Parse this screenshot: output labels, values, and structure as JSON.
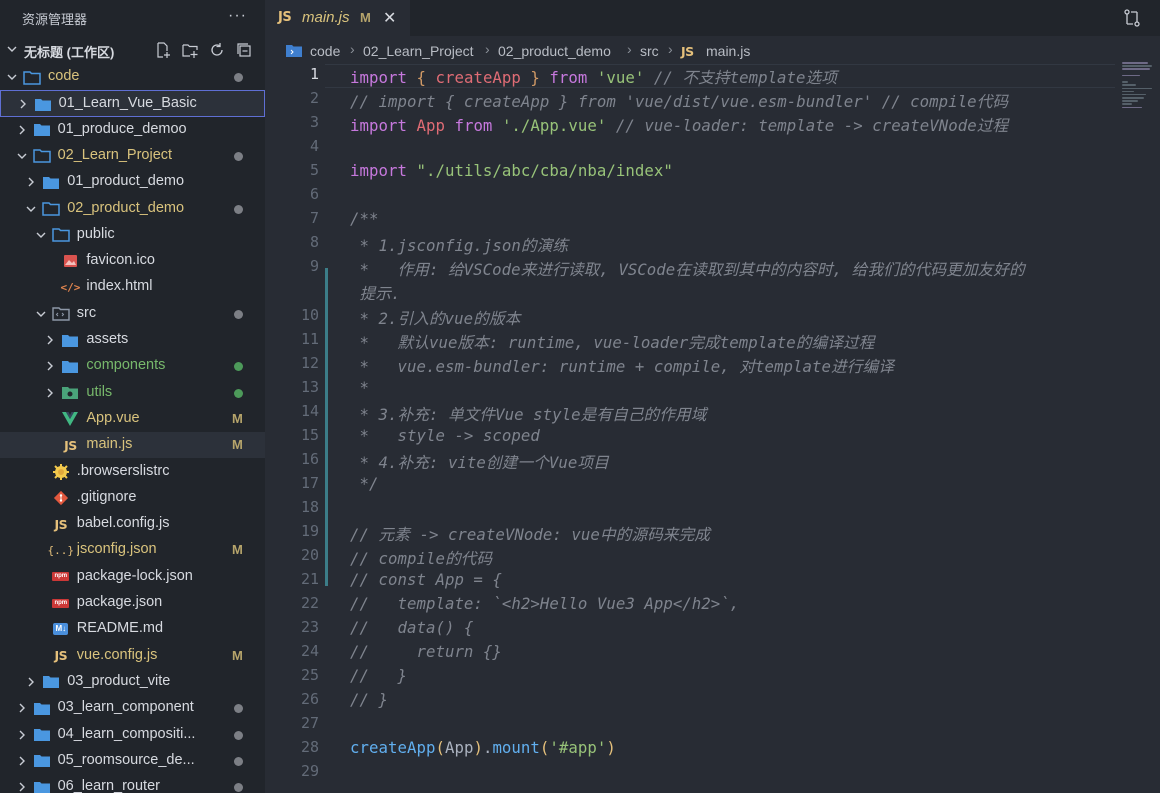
{
  "sidebar": {
    "title": "资源管理器",
    "more": "···",
    "workspace": "无标题 (工作区)",
    "tree": [
      {
        "label": "code",
        "depth": 0,
        "type": "folder-open",
        "status": "dot",
        "color": "mod"
      },
      {
        "label": "01_Learn_Vue_Basic",
        "depth": 1,
        "type": "folder",
        "status": "",
        "color": "norm",
        "selected": true
      },
      {
        "label": "01_produce_demoo",
        "depth": 1,
        "type": "folder",
        "status": "",
        "color": "norm"
      },
      {
        "label": "02_Learn_Project",
        "depth": 1,
        "type": "folder-open",
        "status": "dot",
        "color": "mod"
      },
      {
        "label": "01_product_demo",
        "depth": 2,
        "type": "folder",
        "status": "",
        "color": "norm"
      },
      {
        "label": "02_product_demo",
        "depth": 2,
        "type": "folder-open",
        "status": "dot",
        "color": "mod"
      },
      {
        "label": "public",
        "depth": 3,
        "type": "folder-open",
        "status": "",
        "color": "norm"
      },
      {
        "label": "favicon.ico",
        "depth": 4,
        "type": "image",
        "status": "",
        "color": "norm"
      },
      {
        "label": "index.html",
        "depth": 4,
        "type": "html",
        "status": "",
        "color": "norm"
      },
      {
        "label": "src",
        "depth": 3,
        "type": "src",
        "status": "dot",
        "color": "norm"
      },
      {
        "label": "assets",
        "depth": 4,
        "type": "folder",
        "status": "",
        "color": "norm",
        "chev": true
      },
      {
        "label": "components",
        "depth": 4,
        "type": "folder",
        "status": "green",
        "color": "green",
        "chev": true
      },
      {
        "label": "utils",
        "depth": 4,
        "type": "utils",
        "status": "green",
        "color": "green",
        "chev": true
      },
      {
        "label": "App.vue",
        "depth": 4,
        "type": "vue",
        "status": "M",
        "color": "mod"
      },
      {
        "label": "main.js",
        "depth": 4,
        "type": "js",
        "status": "M",
        "color": "mod",
        "active": true
      },
      {
        "label": ".browserslistrc",
        "depth": 3,
        "type": "browsers",
        "status": "",
        "color": "norm"
      },
      {
        "label": ".gitignore",
        "depth": 3,
        "type": "git",
        "status": "",
        "color": "norm"
      },
      {
        "label": "babel.config.js",
        "depth": 3,
        "type": "js",
        "status": "",
        "color": "norm"
      },
      {
        "label": "jsconfig.json",
        "depth": 3,
        "type": "json",
        "status": "M",
        "color": "mod"
      },
      {
        "label": "package-lock.json",
        "depth": 3,
        "type": "npm",
        "status": "",
        "color": "norm"
      },
      {
        "label": "package.json",
        "depth": 3,
        "type": "npm",
        "status": "",
        "color": "norm"
      },
      {
        "label": "README.md",
        "depth": 3,
        "type": "md",
        "status": "",
        "color": "norm"
      },
      {
        "label": "vue.config.js",
        "depth": 3,
        "type": "js",
        "status": "M",
        "color": "mod"
      },
      {
        "label": "03_product_vite",
        "depth": 2,
        "type": "folder",
        "status": "",
        "color": "norm"
      },
      {
        "label": "03_learn_component",
        "depth": 1,
        "type": "folder",
        "status": "dot",
        "color": "norm"
      },
      {
        "label": "04_learn_compositi...",
        "depth": 1,
        "type": "folder",
        "status": "dot",
        "color": "norm"
      },
      {
        "label": "05_roomsource_de...",
        "depth": 1,
        "type": "folder",
        "status": "dot",
        "color": "norm"
      },
      {
        "label": "06_learn_router",
        "depth": 1,
        "type": "folder",
        "status": "dot",
        "color": "norm"
      }
    ]
  },
  "editor": {
    "tab": {
      "badge": "JS",
      "name": "main.js",
      "modified": "M",
      "close": "✕"
    },
    "breadcrumb": [
      "code",
      "02_Learn_Project",
      "02_product_demo",
      "src",
      "main.js"
    ],
    "breadcrumb_js_badge": "JS",
    "line_numbers": [
      "1",
      "2",
      "3",
      "4",
      "5",
      "6",
      "7",
      "8",
      "9",
      "",
      "10",
      "11",
      "12",
      "13",
      "14",
      "15",
      "16",
      "17",
      "18",
      "19",
      "20",
      "21",
      "22",
      "23",
      "24",
      "25",
      "26",
      "27",
      "28",
      "29"
    ],
    "code": [
      [
        [
          "kw",
          "import"
        ],
        [
          "p",
          " "
        ],
        [
          "brace",
          "{"
        ],
        [
          "p",
          " "
        ],
        [
          "var",
          "createApp"
        ],
        [
          "p",
          " "
        ],
        [
          "brace",
          "}"
        ],
        [
          "p",
          " "
        ],
        [
          "kw",
          "from"
        ],
        [
          "p",
          " "
        ],
        [
          "str",
          "'vue'"
        ],
        [
          "p",
          " "
        ],
        [
          "cm",
          "// 不支持template选项"
        ]
      ],
      [
        [
          "cm",
          "// import { createApp } from 'vue/dist/vue.esm-bundler' // compile代码"
        ]
      ],
      [
        [
          "kw",
          "import"
        ],
        [
          "p",
          " "
        ],
        [
          "var",
          "App"
        ],
        [
          "p",
          " "
        ],
        [
          "kw",
          "from"
        ],
        [
          "p",
          " "
        ],
        [
          "str",
          "'./App.vue'"
        ],
        [
          "p",
          " "
        ],
        [
          "cm",
          "// vue-loader: template -> createVNode过程"
        ]
      ],
      [],
      [
        [
          "kw",
          "import"
        ],
        [
          "p",
          " "
        ],
        [
          "str",
          "\"./utils/abc/cba/nba/index\""
        ]
      ],
      [],
      [
        [
          "cm",
          "/**"
        ]
      ],
      [
        [
          "cm",
          " * 1.jsconfig.json的演练"
        ]
      ],
      [
        [
          "cm",
          " *   作用: 给VSCode来进行读取, VSCode在读取到其中的内容时, 给我们的代码更加友好的"
        ]
      ],
      [
        [
          "cm",
          " 提示."
        ]
      ],
      [
        [
          "cm",
          " * 2.引入的vue的版本"
        ]
      ],
      [
        [
          "cm",
          " *   默认vue版本: runtime, vue-loader完成template的编译过程"
        ]
      ],
      [
        [
          "cm",
          " *   vue.esm-bundler: runtime + compile, 对template进行编译"
        ]
      ],
      [
        [
          "cm",
          " *"
        ]
      ],
      [
        [
          "cm",
          " * 3.补充: 单文件Vue style是有自己的作用域"
        ]
      ],
      [
        [
          "cm",
          " *   style -> scoped"
        ]
      ],
      [
        [
          "cm",
          " * 4.补充: vite创建一个Vue项目"
        ]
      ],
      [
        [
          "cm",
          " */"
        ]
      ],
      [],
      [
        [
          "cm",
          "// 元素 -> createVNode: vue中的源码来完成"
        ]
      ],
      [
        [
          "cm",
          "// compile的代码"
        ]
      ],
      [
        [
          "cm",
          "// const App = {"
        ]
      ],
      [
        [
          "cm",
          "//   template: `<h2>Hello Vue3 App</h2>`,"
        ]
      ],
      [
        [
          "cm",
          "//   data() {"
        ]
      ],
      [
        [
          "cm",
          "//     return {}"
        ]
      ],
      [
        [
          "cm",
          "//   }"
        ]
      ],
      [
        [
          "cm",
          "// }"
        ]
      ],
      [],
      [
        [
          "fn",
          "createApp"
        ],
        [
          "paren",
          "("
        ],
        [
          "p",
          "App"
        ],
        [
          "paren",
          ")"
        ],
        [
          "p",
          "."
        ],
        [
          "fn",
          "mount"
        ],
        [
          "paren",
          "("
        ],
        [
          "str",
          "'#app'"
        ],
        [
          "paren",
          ")"
        ]
      ],
      []
    ]
  }
}
